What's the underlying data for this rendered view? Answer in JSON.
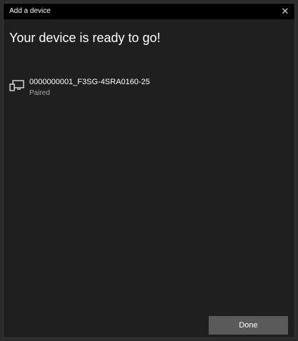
{
  "window": {
    "title": "Add a device",
    "close_glyph": "✕"
  },
  "main": {
    "heading": "Your device is ready to go!",
    "device": {
      "icon": "display-device-icon",
      "name": "0000000001_F3SG-4SRA0160-25",
      "status": "Paired"
    }
  },
  "footer": {
    "done_label": "Done"
  },
  "colors": {
    "background": "#1f1f1f",
    "titlebar": "#000000",
    "button": "#5a5a5a",
    "text": "#ffffff",
    "secondary_text": "#a8a8a8"
  }
}
